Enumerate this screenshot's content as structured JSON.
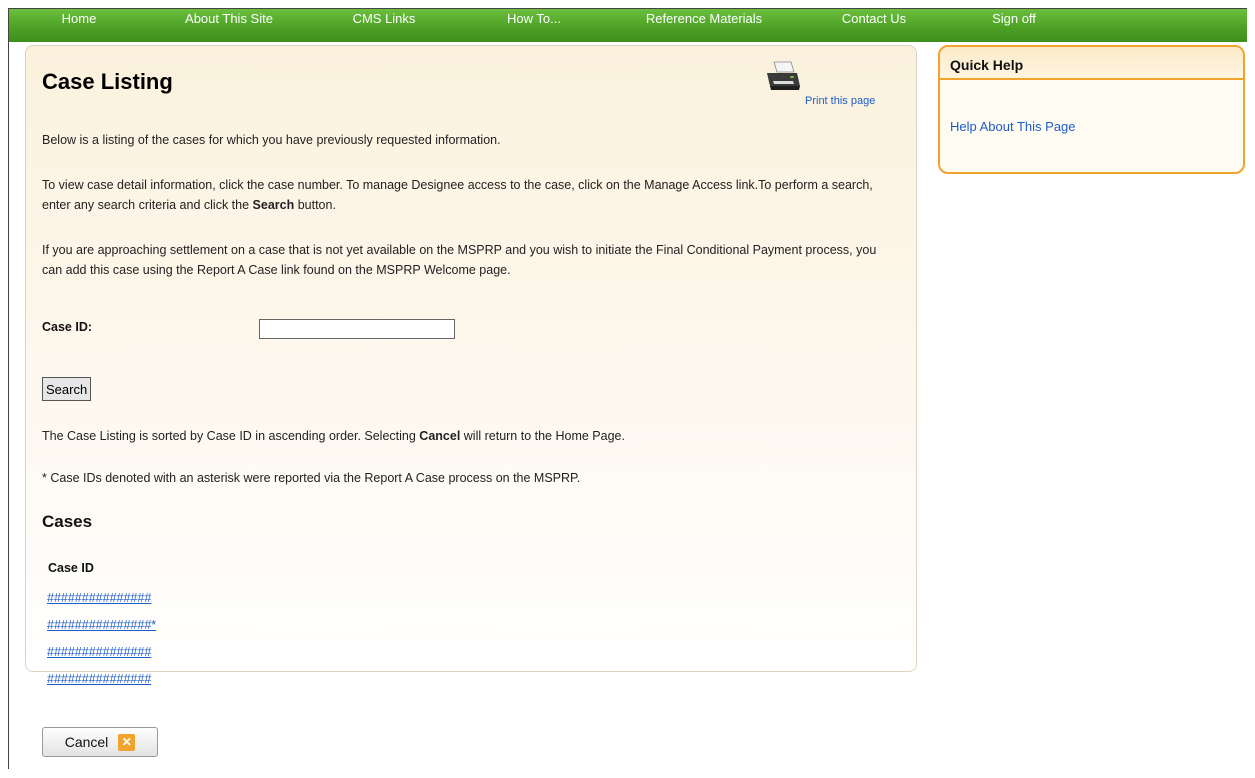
{
  "nav": {
    "items": [
      "Home",
      "About This Site",
      "CMS Links",
      "How To...",
      "Reference Materials",
      "Contact Us",
      "Sign off"
    ]
  },
  "main": {
    "title": "Case Listing",
    "print_link": "Print this page",
    "paragraph1": "Below is a listing of the cases for which you have previously requested information.",
    "paragraph2_text": "To view case detail information, click the case number. To manage Designee access to the case, click on the Manage Access link.To perform a search, enter any search criteria and click the ",
    "paragraph2_bold": "Search",
    "paragraph2_end": " button.",
    "paragraph3": "If you are approaching settlement on a case that is not yet available on the MSPRP and you wish to initiate the Final Conditional Payment process, you can add this case using the Report A Case link found on the MSPRP Welcome page.",
    "case_id_label": "Case ID:",
    "case_id_value": "",
    "search_button": "Search",
    "sort_text_start": "The Case Listing is sorted by Case ID in ascending order. Selecting ",
    "sort_text_bold": "Cancel",
    "sort_text_end": " will return to the Home Page.",
    "asterisk_note": "* Case IDs denoted with an asterisk were reported via the Report A Case process on the MSPRP.",
    "cases_heading": "Cases",
    "cases_column_header": "Case ID",
    "cases": [
      "###############",
      "###############*",
      "###############",
      "###############"
    ]
  },
  "quick_help": {
    "title": "Quick Help",
    "link": "Help About This Page"
  },
  "cancel_button": "Cancel",
  "colors": {
    "nav_green": "#4a9f23",
    "link_blue": "#1f5dc6",
    "help_border_orange": "#f0a32d"
  }
}
